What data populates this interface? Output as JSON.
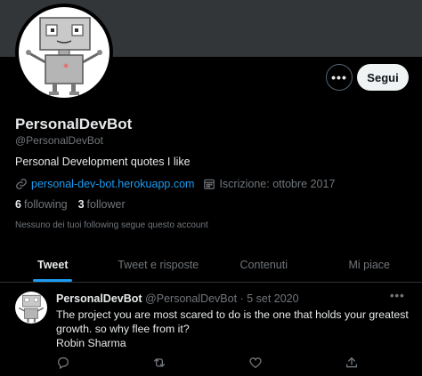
{
  "profile": {
    "name": "PersonalDevBot",
    "handle": "@PersonalDevBot",
    "bio": "Personal Development quotes I like",
    "website": "personal-dev-bot.herokuapp.com",
    "joined": "Iscrizione: ottobre 2017",
    "following_count": "6",
    "following_label": "following",
    "follower_count": "3",
    "follower_label": "follower",
    "followed_by_note": "Nessuno dei tuoi following segue questo account"
  },
  "actions": {
    "more_label": "•••",
    "follow_label": "Segui"
  },
  "tabs": [
    {
      "label": "Tweet",
      "active": true
    },
    {
      "label": "Tweet e risposte",
      "active": false
    },
    {
      "label": "Contenuti",
      "active": false
    },
    {
      "label": "Mi piace",
      "active": false
    }
  ],
  "tweet": {
    "name": "PersonalDevBot",
    "handle": "@PersonalDevBot",
    "separator": "·",
    "date": "5 set 2020",
    "more_label": "•••",
    "lines": [
      "The project you are most scared to do is the one that holds your greatest",
      "growth. so why flee from it?",
      "Robin Sharma"
    ]
  },
  "icons": {
    "link": "link-icon",
    "calendar": "calendar-icon",
    "reply": "reply-icon",
    "retweet": "retweet-icon",
    "like": "heart-icon",
    "share": "share-icon"
  },
  "colors": {
    "accent": "#1d9bf0",
    "banner": "#333639",
    "muted": "#71767b"
  }
}
